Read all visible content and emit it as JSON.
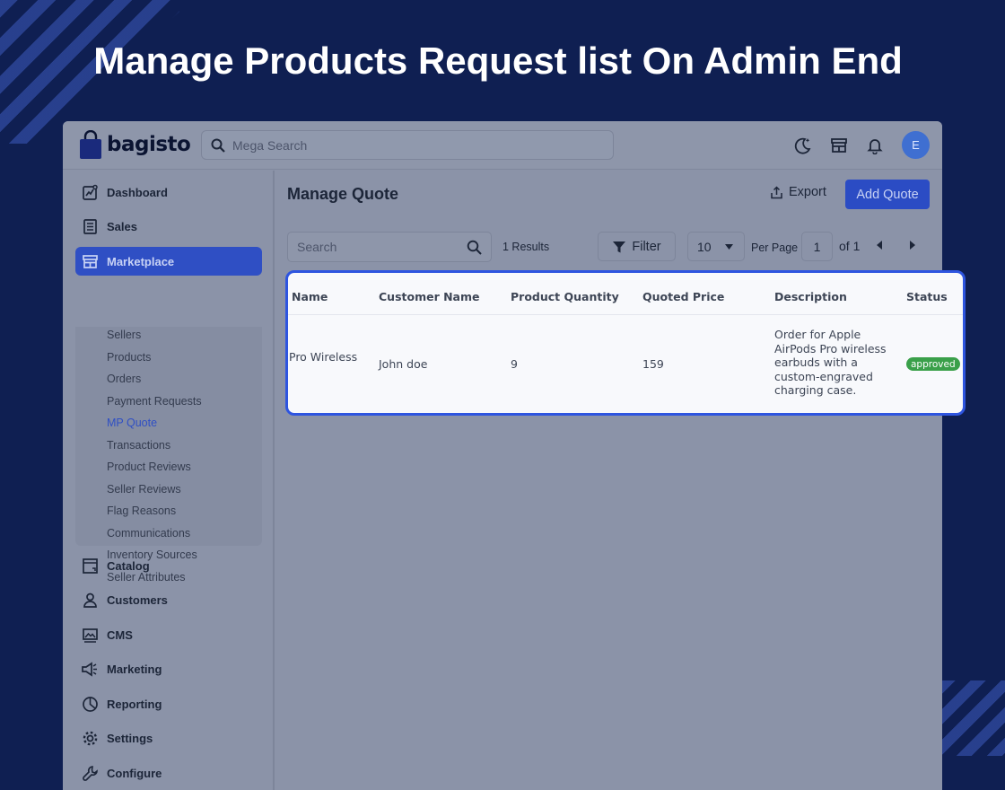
{
  "headline": "Manage Products Request list On Admin End",
  "brand": {
    "name": "bagisto",
    "accent": "#2f4fc4",
    "bag_color": "#2438a8"
  },
  "topbar": {
    "search_placeholder": "Mega Search",
    "icons": [
      "dark-mode-icon",
      "storefront-icon",
      "bell-icon"
    ],
    "avatar_initial": "E"
  },
  "sidebar": {
    "items": [
      {
        "label": "Dashboard",
        "icon": "dashboard-icon"
      },
      {
        "label": "Sales",
        "icon": "sales-icon"
      },
      {
        "label": "Marketplace",
        "icon": "marketplace-icon",
        "active": true
      },
      {
        "label": "Catalog",
        "icon": "catalog-icon"
      },
      {
        "label": "Customers",
        "icon": "customers-icon"
      },
      {
        "label": "CMS",
        "icon": "cms-icon"
      },
      {
        "label": "Marketing",
        "icon": "marketing-icon"
      },
      {
        "label": "Reporting",
        "icon": "reporting-icon"
      },
      {
        "label": "Settings",
        "icon": "settings-icon"
      },
      {
        "label": "Configure",
        "icon": "configure-icon"
      }
    ],
    "submenu": [
      "Sellers",
      "Products",
      "Orders",
      "Payment Requests",
      "MP Quote",
      "Transactions",
      "Product Reviews",
      "Seller Reviews",
      "Flag Reasons",
      "Communications",
      "Inventory Sources",
      "Seller Attributes"
    ],
    "submenu_active": "MP Quote"
  },
  "main": {
    "title": "Manage Quote",
    "export_label": "Export",
    "add_label": "Add Quote",
    "search_placeholder": "Search",
    "results": "1 Results",
    "filter_label": "Filter",
    "per_page_value": "10",
    "per_page_label": "Per Page",
    "page_value": "1",
    "page_total": "of 1"
  },
  "table": {
    "columns": [
      "Name",
      "Customer Name",
      "Product Quantity",
      "Quoted Price",
      "Description",
      "Status"
    ],
    "rows": [
      {
        "name": "Pro Wireless",
        "customer": "John doe",
        "quantity": "9",
        "price": "159",
        "description": "Order for Apple AirPods Pro wireless earbuds with a custom-engraved charging case.",
        "status": "approved"
      }
    ],
    "status_color": "#3aa04a"
  }
}
